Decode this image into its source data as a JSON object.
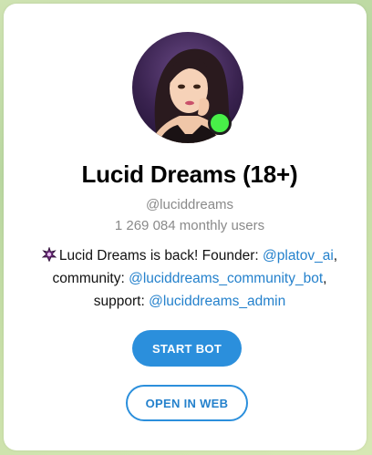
{
  "profile": {
    "title": "Lucid Dreams (18+)",
    "username": "@luciddreams",
    "monthly_users": "1 269 084 monthly users",
    "online": true,
    "online_color": "#48f048"
  },
  "description": {
    "icon": "sparkle-star-icon",
    "text_1": "Lucid Dreams is back! Founder: ",
    "founder_link": "@platov_ai",
    "text_2": ",",
    "text_3": "community: ",
    "community_link": "@luciddreams_community_bot",
    "text_4": ",",
    "text_5": "support: ",
    "support_link": "@luciddreams_admin"
  },
  "actions": {
    "start_bot": "START BOT",
    "open_web": "OPEN IN WEB"
  },
  "colors": {
    "accent": "#2b8fdc",
    "link": "#2481cc",
    "muted": "#8a8a8a"
  }
}
